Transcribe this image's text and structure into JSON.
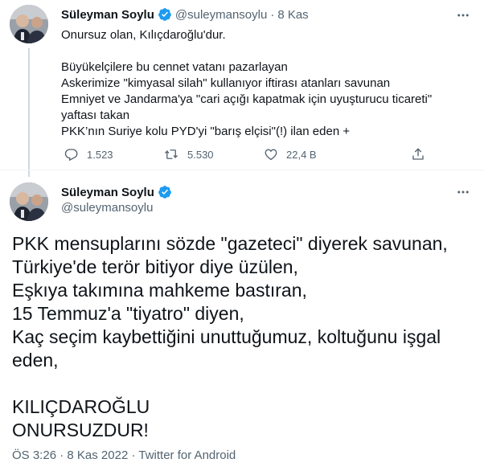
{
  "tweet1": {
    "author_name": "Süleyman Soylu",
    "author_handle": "@suleymansoylu",
    "separator": "·",
    "date": "8 Kas",
    "lines": [
      "Onursuz olan, Kılıçdaroğlu'dur.",
      "",
      "Büyükelçilere bu cennet vatanı pazarlayan",
      "Askerimize \"kimyasal silah\" kullanıyor iftirası atanları savunan",
      "Emniyet ve Jandarma'ya \"cari açığı kapatmak için uyuşturucu ticareti\"",
      "yaftası takan",
      "PKK’nın Suriye kolu PYD'yi \"barış elçisi\"(!) ilan eden +"
    ],
    "reply_count": "1.523",
    "retweet_count": "5.530",
    "like_count": "22,4 B"
  },
  "tweet2": {
    "author_name": "Süleyman Soylu",
    "author_handle": "@suleymansoylu",
    "lines": [
      "PKK mensuplarını sözde \"gazeteci\" diyerek savunan,",
      "Türkiye'de terör bitiyor diye üzülen,",
      "Eşkıya takımına mahkeme bastıran,",
      "15 Temmuz'a \"tiyatro\" diyen,",
      "Kaç seçim kaybettiğini unuttuğumuz, koltuğunu işgal",
      "eden,",
      "",
      "KILIÇDAROĞLU",
      "ONURSUZDUR!"
    ],
    "time": "ÖS 3:26",
    "date": "8 Kas 2022",
    "source": "Twitter for Android"
  },
  "icons": {
    "verified": "verified-badge-icon",
    "more": "more-icon",
    "reply": "reply-icon",
    "retweet": "retweet-icon",
    "like": "like-icon",
    "share": "share-icon"
  },
  "colors": {
    "verified_blue": "#1d9bf0",
    "secondary_text": "#536471",
    "primary_text": "#0f1419",
    "thread_line": "#cfd9de"
  }
}
